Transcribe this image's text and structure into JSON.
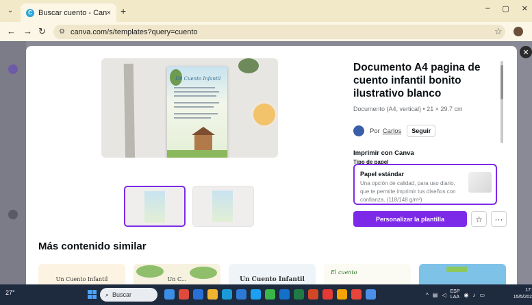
{
  "browser": {
    "tab_title": "Buscar cuento - Canva",
    "url": "canva.com/s/templates?query=cuento",
    "tab_close": "×",
    "new_tab": "+",
    "minimize": "–",
    "maximize": "▢",
    "close": "✕"
  },
  "modal": {
    "title": "Documento A4 pagina de cuento infantil bonito ilustrativo blanco",
    "meta": "Documento (A4, vertical) • 21 × 29.7 cm",
    "author_prefix": "Por",
    "author_name": "Carlos",
    "follow_label": "Seguir",
    "print_heading": "Imprimir con Canva",
    "paper_type_label": "Tipo de papel",
    "paper_name": "Papel estándar",
    "paper_description": "Una opción de calidad, para uso diario, que te permite imprimir tus diseños con confianza. (118/148 g/m²)",
    "primary_button": "Personalizar la plantilla",
    "similar_heading": "Más contenido similar",
    "close_label": "✕",
    "preview_doc_title": "Un Cuento Infantil"
  },
  "cards": [
    {
      "label": "Un Cuento Infantil"
    },
    {
      "label": "Un C..."
    },
    {
      "label": "Un Cuento Infantil"
    },
    {
      "label": "El cuento"
    },
    {
      "label": ""
    }
  ],
  "taskbar": {
    "weather_temp": "27°",
    "search_placeholder": "Buscar",
    "lang_line1": "ESP",
    "lang_line2": "LAA",
    "time": "17:",
    "date": "15/5/202"
  },
  "colors": {
    "accent": "#7d2ae8",
    "browser_tab_bar": "#f2e9c9",
    "taskbar": "#1e2a3e"
  }
}
